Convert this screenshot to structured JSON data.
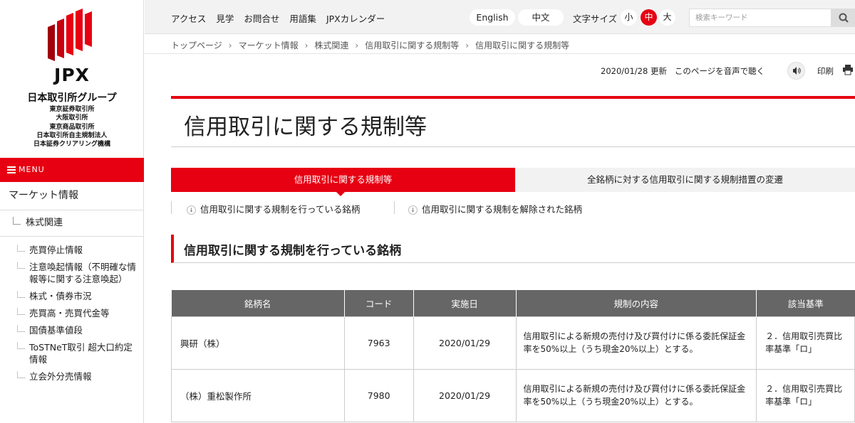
{
  "logo": {
    "brand": "JPX",
    "group_name": "日本取引所グループ",
    "subsidiaries": [
      "東京証券取引所",
      "大阪取引所",
      "東京商品取引所",
      "日本取引所自主規制法人",
      "日本証券クリアリング機構"
    ],
    "colors": [
      "#e60012",
      "#c8000f",
      "#a0000c"
    ]
  },
  "sidebar": {
    "menu_label": "MENU",
    "category": "マーケット情報",
    "subcategory": "株式関連",
    "items": [
      "売買停止情報",
      "注意喚起情報（不明確な情報等に関する注意喚起）",
      "株式・債券市況",
      "売買高・売買代金等",
      "国債基準値段",
      "ToSTNeT取引 超大口約定情報",
      "立会外分売情報"
    ]
  },
  "topbar": {
    "nav": [
      "アクセス",
      "見学",
      "お問合せ",
      "用語集",
      "JPXカレンダー"
    ],
    "lang_en": "English",
    "lang_zh": "中文",
    "font_size_label": "文字サイズ",
    "font_sizes": [
      "小",
      "中",
      "大"
    ],
    "font_size_active": "中",
    "search_placeholder": "検索キーワード",
    "search_icon": "search-icon"
  },
  "breadcrumb": [
    "トップページ",
    "マーケット情報",
    "株式関連",
    "信用取引に関する規制等",
    "信用取引に関する規制等"
  ],
  "utility": {
    "updated": "2020/01/28 更新",
    "read_aloud": "このページを音声で聴く",
    "print": "印刷"
  },
  "page": {
    "title": "信用取引に関する規制等",
    "tabs": [
      "信用取引に関する規制等",
      "全銘柄に対する信用取引に関する規制措置の変遷"
    ],
    "anchors": [
      "信用取引に関する規制を行っている銘柄",
      "信用取引に関する規制を解除された銘柄"
    ],
    "section_title": "信用取引に関する規制を行っている銘柄"
  },
  "table": {
    "headers": [
      "銘柄名",
      "コード",
      "実施日",
      "規制の内容",
      "該当基準"
    ],
    "rows": [
      {
        "name": "興研（株）",
        "code": "7963",
        "date": "2020/01/29",
        "content": "信用取引による新規の売付け及び買付けに係る委託保証金率を50%以上（うち現金20%以上）とする。",
        "criteria": "２．信用取引売買比率基準「ロ」"
      },
      {
        "name": "（株）重松製作所",
        "code": "7980",
        "date": "2020/01/29",
        "content": "信用取引による新規の売付け及び買付けに係る委託保証金率を50%以上（うち現金20%以上）とする。",
        "criteria": "２．信用取引売買比率基準「ロ」"
      }
    ]
  },
  "accent_color": "#e60012"
}
